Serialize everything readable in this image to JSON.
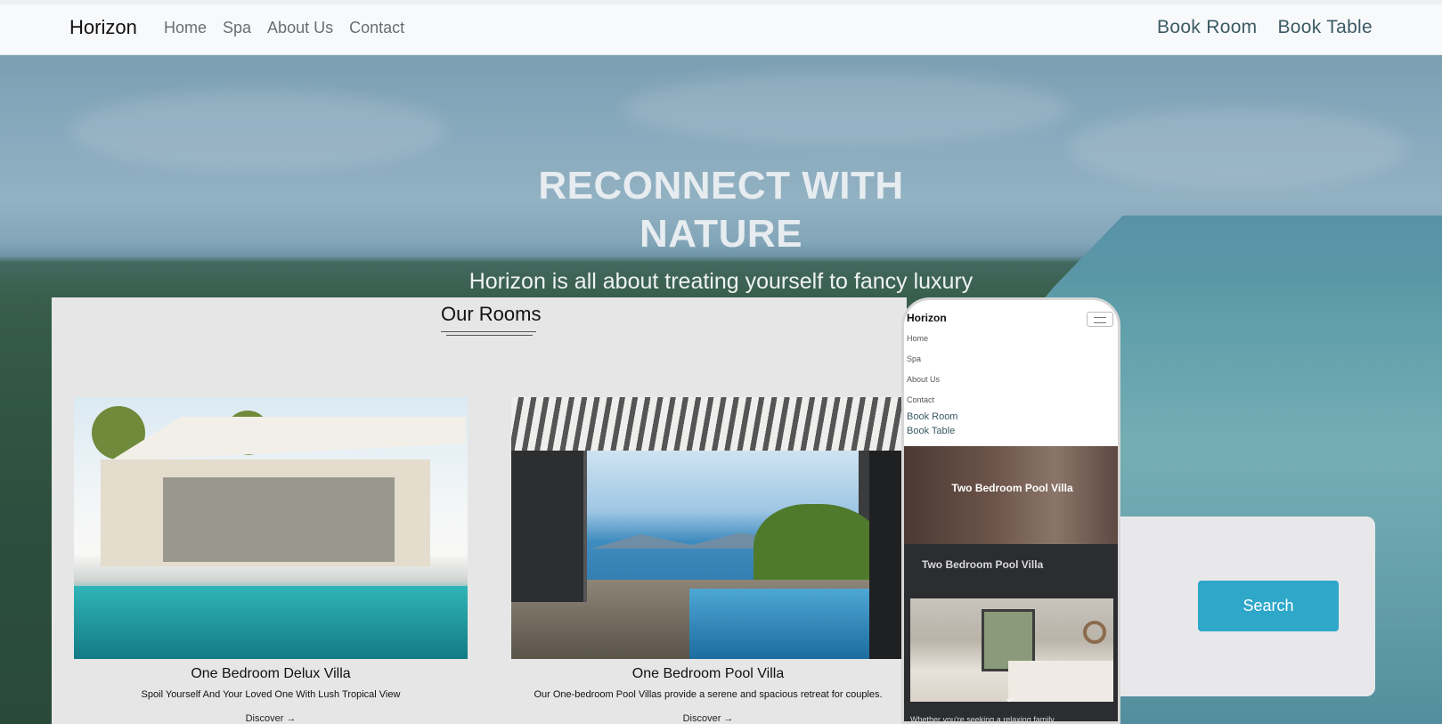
{
  "navbar": {
    "brand": "Horizon",
    "links": [
      "Home",
      "Spa",
      "About Us",
      "Contact"
    ],
    "book_room": "Book Room",
    "book_table": "Book Table"
  },
  "hero": {
    "title_line1": "RECONNECT WITH",
    "title_line2": "NATURE",
    "subtitle": "Horizon is all about treating yourself to fancy luxury"
  },
  "rooms": {
    "title": "Our Rooms",
    "items": [
      {
        "name": "One Bedroom Delux Villa",
        "description": "Spoil Yourself And Your Loved One With Lush Tropical View",
        "link": "Discover →"
      },
      {
        "name": "One Bedroom Pool Villa",
        "description": "Our One-bedroom Pool Villas provide a serene and spacious retreat for couples.",
        "link": "Discover →"
      }
    ]
  },
  "search": {
    "button_label": "Search"
  },
  "phone": {
    "brand": "Horizon",
    "links": [
      "Home",
      "Spa",
      "About Us",
      "Contact"
    ],
    "book_room": "Book Room",
    "book_table": "Book Table",
    "hero_title": "Two Bedroom Pool Villa",
    "card_title": "Two Bedroom Pool Villa",
    "chevron": "⌄",
    "body_text": "Whether you're seeking a relaxing family"
  }
}
